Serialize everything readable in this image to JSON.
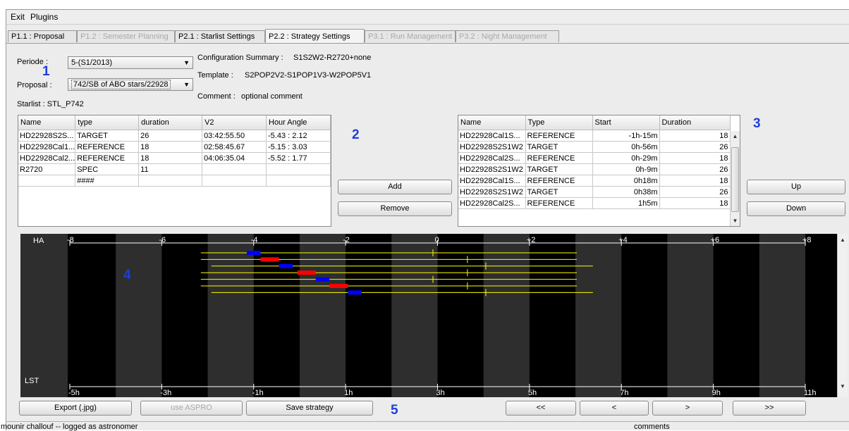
{
  "menu": {
    "items": [
      "Exit",
      "Plugins"
    ]
  },
  "tabs": [
    {
      "label": "P1.1 : Proposal",
      "state": "normal"
    },
    {
      "label": "P1.2 : Semester Planning",
      "state": "disabled"
    },
    {
      "label": "P2.1 : Starlist Settings",
      "state": "normal"
    },
    {
      "label": "P2.2 : Strategy Settings",
      "state": "active"
    },
    {
      "label": "P3.1 : Run Management",
      "state": "disabled"
    },
    {
      "label": "P3.2 : Night Management",
      "state": "disabled"
    }
  ],
  "form": {
    "periode_label": "Periode :",
    "periode_value": "5-(S1/2013)",
    "proposal_label": "Proposal :",
    "proposal_value": "742/SB of ABO stars/22928",
    "starlist_label": "Starlist : STL_P742",
    "config_label": "Configuration Summary :",
    "config_value": "S1S2W2-R2720+none",
    "template_label": "Template :",
    "template_value": "S2POP2V2-S1POP1V3-W2POP5V1",
    "comment_label": "Comment :",
    "comment_value": "optional comment"
  },
  "annotations": [
    "1",
    "2",
    "3",
    "4",
    "5"
  ],
  "starlist_table": {
    "columns": [
      "Name",
      "type",
      "duration",
      "V2",
      "Hour Angle"
    ],
    "rows": [
      [
        "HD22928S2S...",
        "TARGET",
        "26",
        "03:42:55.50",
        "-5.43 : 2.12"
      ],
      [
        "HD22928Cal1...",
        "REFERENCE",
        "18",
        "02:58:45.67",
        "-5.15 : 3.03"
      ],
      [
        "HD22928Cal2...",
        "REFERENCE",
        "18",
        "04:06:35.04",
        "-5.52 : 1.77"
      ],
      [
        "R2720",
        "SPEC",
        "11",
        "",
        ""
      ],
      [
        "",
        "####",
        "",
        "",
        ""
      ]
    ]
  },
  "middle_buttons": {
    "add": "Add",
    "remove": "Remove"
  },
  "strategy_table": {
    "columns": [
      "Name",
      "Type",
      "Start",
      "Duration"
    ],
    "rows": [
      [
        "HD22928Cal1S...",
        "REFERENCE",
        "-1h-15m",
        "18"
      ],
      [
        "HD22928S2S1W2",
        "TARGET",
        "0h-56m",
        "26"
      ],
      [
        "HD22928Cal2S...",
        "REFERENCE",
        "0h-29m",
        "18"
      ],
      [
        "HD22928S2S1W2",
        "TARGET",
        "0h-9m",
        "26"
      ],
      [
        "HD22928Cal1S...",
        "REFERENCE",
        "0h18m",
        "18"
      ],
      [
        "HD22928S2S1W2",
        "TARGET",
        "0h38m",
        "26"
      ],
      [
        "HD22928Cal2S...",
        "REFERENCE",
        "1h5m",
        "18"
      ]
    ]
  },
  "right_buttons": {
    "up": "Up",
    "down": "Down"
  },
  "chart_data": {
    "type": "timeline",
    "top_axis_label": "HA",
    "bottom_axis_label": "LST",
    "ha_ticks": [
      "-8",
      "-6",
      "-4",
      "-2",
      "0",
      "+2",
      "+4",
      "+6",
      "+8"
    ],
    "ha_range": [
      -8,
      8
    ],
    "lst_ticks": [
      "-5h",
      "-3h",
      "-1h",
      "1h",
      "3h",
      "5h",
      "7h",
      "9h",
      "11h"
    ],
    "colors": {
      "background": "#000000",
      "band": "#2e2e2e",
      "line": "#ffff00",
      "target": "#0000ff",
      "reference": "#ff0000",
      "axis": "#ffffff"
    },
    "tracks": [
      {
        "ha_start": -5.15,
        "ha_end": 3.03,
        "marker_ha": -0.1,
        "block_start": -4.15,
        "block_end": -3.85,
        "block_type": "target"
      },
      {
        "ha_start": -5.15,
        "ha_end": 3.03,
        "marker_ha": 0.65,
        "block_start": -3.85,
        "block_end": -3.45,
        "block_type": "reference"
      },
      {
        "ha_start": -4.92,
        "ha_end": 3.38,
        "marker_ha": 1.05,
        "block_start": -3.45,
        "block_end": -3.15,
        "block_type": "target"
      },
      {
        "ha_start": -5.15,
        "ha_end": 3.03,
        "marker_ha": 0.65,
        "block_start": -3.05,
        "block_end": -2.65,
        "block_type": "reference"
      },
      {
        "ha_start": -5.15,
        "ha_end": 3.03,
        "marker_ha": -0.1,
        "block_start": -2.65,
        "block_end": -2.35,
        "block_type": "target"
      },
      {
        "ha_start": -5.15,
        "ha_end": 3.03,
        "marker_ha": 0.65,
        "block_start": -2.35,
        "block_end": -1.95,
        "block_type": "reference"
      },
      {
        "ha_start": -4.92,
        "ha_end": 3.38,
        "marker_ha": 1.05,
        "block_start": -1.95,
        "block_end": -1.65,
        "block_type": "target"
      }
    ]
  },
  "bottom_buttons": {
    "export": "Export (.jpg)",
    "aspro": "use ASPRO",
    "save": "Save strategy",
    "first": "<<",
    "prev": "<",
    "next": ">",
    "last": ">>"
  },
  "status": {
    "user": "mounir challouf -- logged as astronomer",
    "comments": "comments"
  }
}
